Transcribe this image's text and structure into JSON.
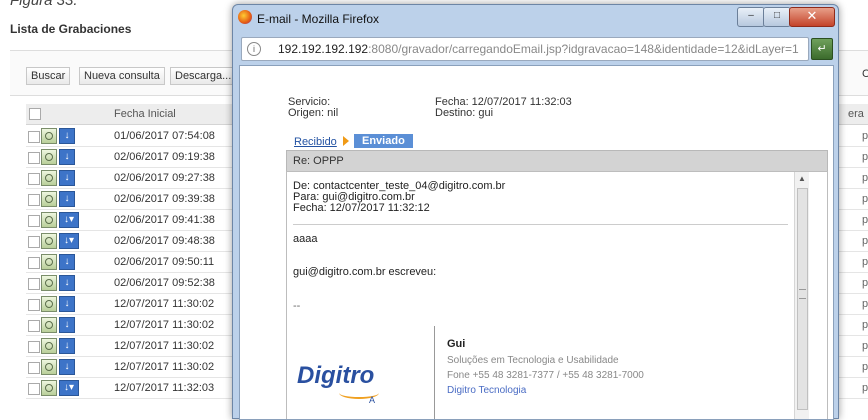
{
  "caption": "Figura 33.",
  "background": {
    "title": "Lista de Grabaciones",
    "toolbar": {
      "buscar": "Buscar",
      "nueva_consulta": "Nueva consulta",
      "descarga": "Descarga..."
    },
    "right_letter": "C",
    "header": {
      "fecha": "Fecha Inicial",
      "era": "era"
    },
    "rows": [
      {
        "date": "01/06/2017 07:54:08",
        "pt": "pt"
      },
      {
        "date": "02/06/2017 09:19:38",
        "pt": "pt"
      },
      {
        "date": "02/06/2017 09:27:38",
        "pt": "pt"
      },
      {
        "date": "02/06/2017 09:39:38",
        "pt": "pt"
      },
      {
        "date": "02/06/2017 09:41:38",
        "pt": "pt"
      },
      {
        "date": "02/06/2017 09:48:38",
        "pt": "pt"
      },
      {
        "date": "02/06/2017 09:50:11",
        "pt": "pt"
      },
      {
        "date": "02/06/2017 09:52:38",
        "pt": "pt"
      },
      {
        "date": "12/07/2017 11:30:02",
        "pt": "pt"
      },
      {
        "date": "12/07/2017 11:30:02",
        "pt": "pt"
      },
      {
        "date": "12/07/2017 11:30:02",
        "pt": "pt"
      },
      {
        "date": "12/07/2017 11:30:02",
        "pt": "pt"
      },
      {
        "date": "12/07/2017 11:32:03",
        "pt": "pt"
      }
    ]
  },
  "popup": {
    "title": "E-mail - Mozilla Firefox",
    "url_host": "192.192.192.192",
    "url_rest": ":8080/gravador/carregandoEmail.jsp?idgravacao=148&identidade=12&idLayer=1",
    "servicio": "Servicio:",
    "origen": "Origen: nil",
    "fecha": "Fecha: 12/07/2017 11:32:03",
    "destino": "Destino: gui",
    "tab_recibido": "Recibido",
    "tab_enviado": "Enviado",
    "subject": "Re: OPPP",
    "message": {
      "de": "De: contactcenter_teste_04@digitro.com.br",
      "para": "Para: gui@digitro.com.br",
      "fecha": "Fecha: 12/07/2017 11:32:12",
      "body": "aaaa",
      "quote": "gui@digitro.com.br escreveu:",
      "dashes": "--"
    },
    "signature": {
      "name": "Gui",
      "line1": "Soluções em Tecnologia e Usabilidade",
      "line2": "Fone +55 48 3281-7377 / +55 48 3281-7000",
      "company": "Digitro Tecnologia",
      "logo": "Digitro",
      "logo_small": "A"
    }
  }
}
